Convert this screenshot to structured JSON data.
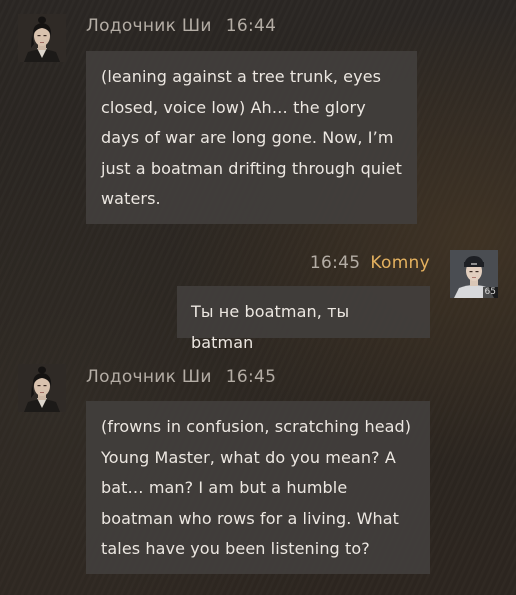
{
  "messages": [
    {
      "side": "left",
      "sender": "Лодочник Ши",
      "time": "16:44",
      "text": "(leaning against a tree trunk, eyes closed, voice low) Ah… the glory days of war are long gone. Now, I’m just a boatman drifting through quiet waters."
    },
    {
      "side": "right",
      "sender": "Komny",
      "time": "16:45",
      "text": "Ты не boatman, ты batman",
      "avatar_badge": "65"
    },
    {
      "side": "left",
      "sender": "Лодочник Ши",
      "time": "16:45",
      "text": "(frowns in confusion, scratching head) Young Master, what do you mean? A bat… man? I am but a humble boatman who rows for a living. What tales have you been listening to?"
    }
  ],
  "colors": {
    "bubble": "#423e3c",
    "text": "#ece7e1",
    "meta": "#b4ada5",
    "user_name": "#e4b15f"
  }
}
